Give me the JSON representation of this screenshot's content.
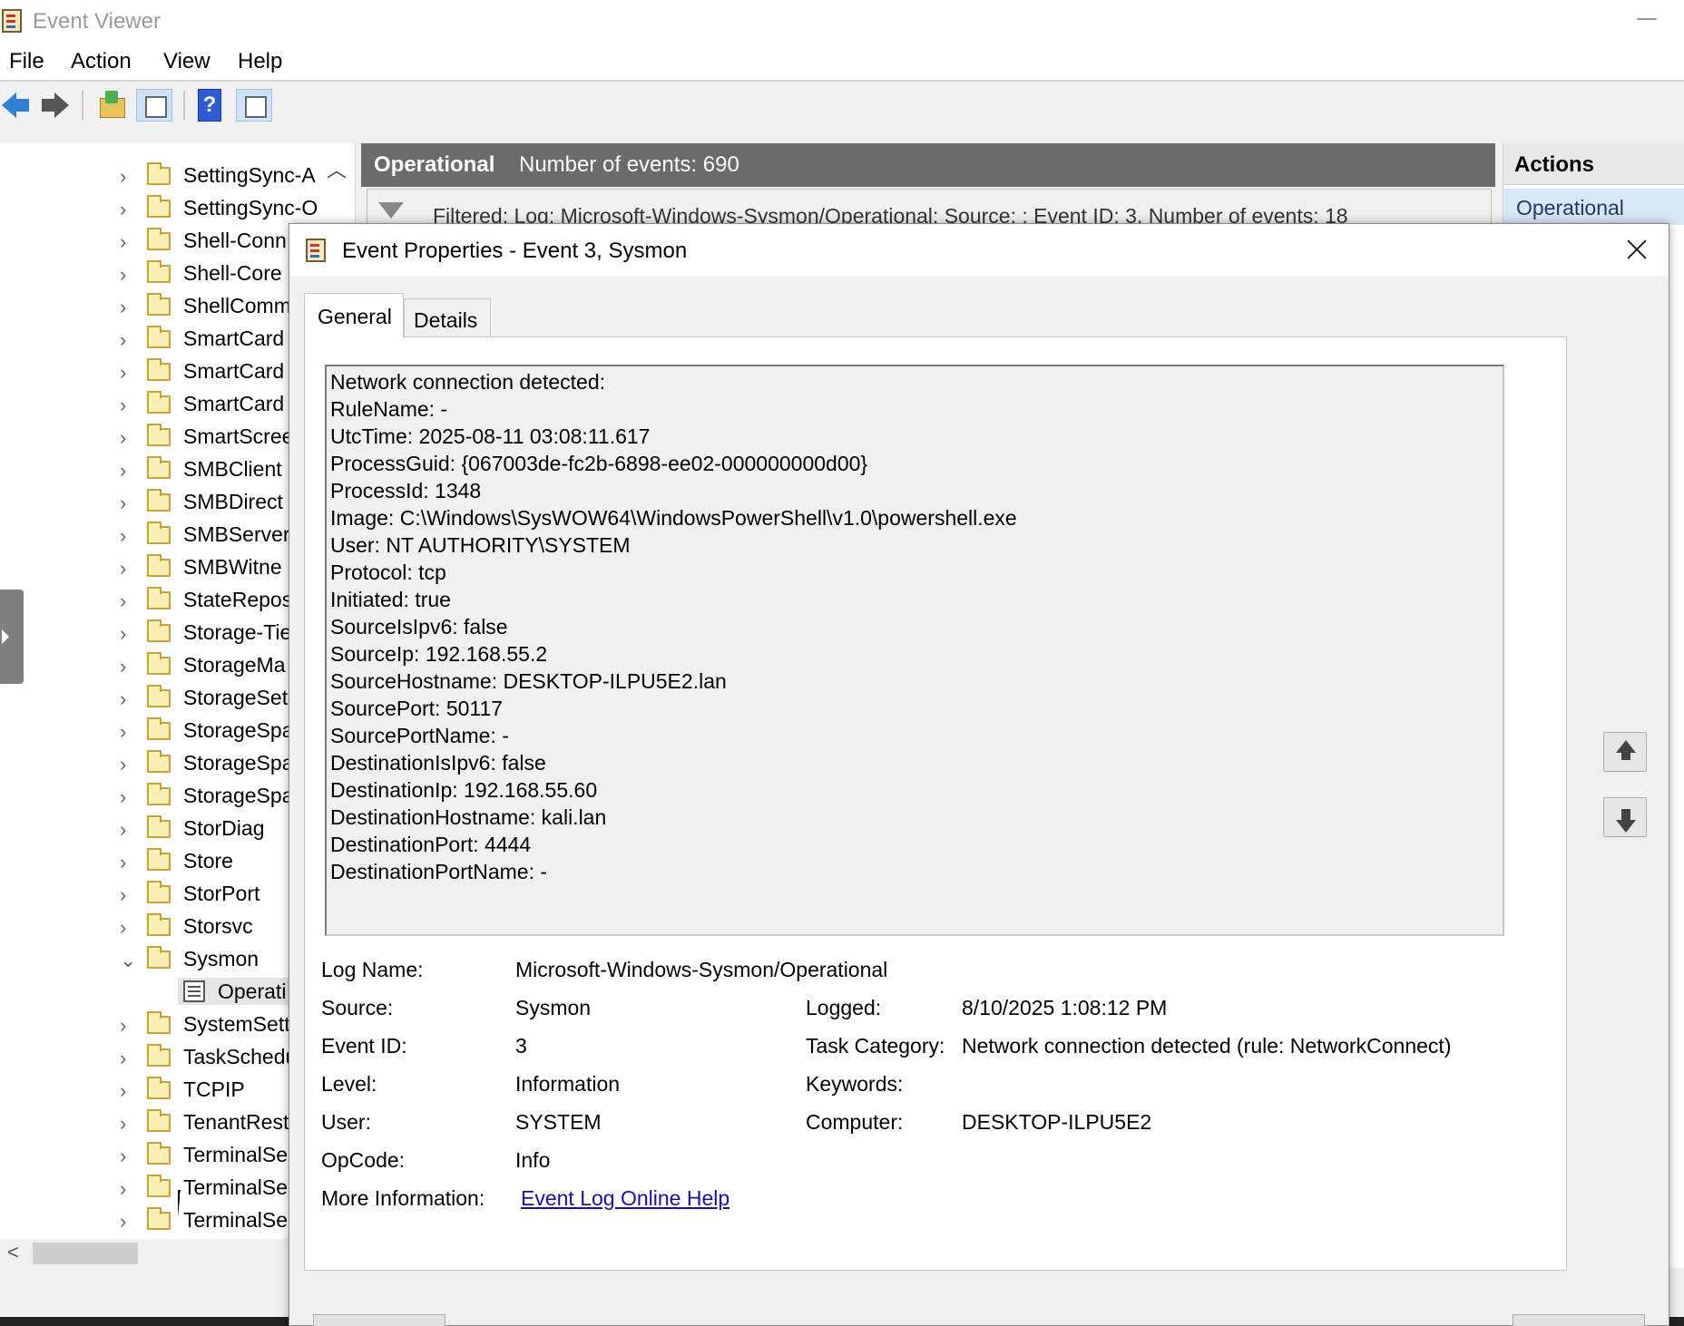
{
  "window": {
    "title": "Event Viewer"
  },
  "menu": [
    "File",
    "Action",
    "View",
    "Help"
  ],
  "tree": {
    "items": [
      "SettingSync-A",
      "SettingSync-O",
      "Shell-Conn",
      "Shell-Core",
      "ShellComm",
      "SmartCard",
      "SmartCard",
      "SmartCard",
      "SmartScree",
      "SMBClient",
      "SMBDirect",
      "SMBServer",
      "SMBWitne",
      "StateRepos",
      "Storage-Tie",
      "StorageMa",
      "StorageSet",
      "StorageSpa",
      "StorageSpa",
      "StorageSpa",
      "StorDiag",
      "Store",
      "StorPort",
      "Storsvc",
      "Sysmon",
      "Operati",
      "SystemSett",
      "TaskSchedu",
      "TCPIP",
      "TenantRest",
      "TerminalSe",
      "TerminalSe",
      "TerminalSe"
    ]
  },
  "center": {
    "log_name": "Operational",
    "event_count": "Number of events: 690",
    "filter_text": "Filtered: Log: Microsoft-Windows-Sysmon/Operational; Source: ; Event ID: 3. Number of events: 18"
  },
  "actions": {
    "header": "Actions",
    "selected": "Operational"
  },
  "dialog": {
    "title": "Event Properties - Event 3, Sysmon",
    "tabs": [
      "General",
      "Details"
    ],
    "description": [
      "Network connection detected:",
      "RuleName: -",
      "UtcTime: 2025-08-11 03:08:11.617",
      "ProcessGuid: {067003de-fc2b-6898-ee02-000000000d00}",
      "ProcessId: 1348",
      "Image: C:\\Windows\\SysWOW64\\WindowsPowerShell\\v1.0\\powershell.exe",
      "User: NT AUTHORITY\\SYSTEM",
      "Protocol: tcp",
      "Initiated: true",
      "SourceIsIpv6: false",
      "SourceIp: 192.168.55.2",
      "SourceHostname: DESKTOP-ILPU5E2.lan",
      "SourcePort: 50117",
      "SourcePortName: -",
      "DestinationIsIpv6: false",
      "DestinationIp: 192.168.55.60",
      "DestinationHostname: kali.lan",
      "DestinationPort: 4444",
      "DestinationPortName: -"
    ],
    "props": {
      "log_name_label": "Log Name:",
      "log_name": "Microsoft-Windows-Sysmon/Operational",
      "source_label": "Source:",
      "source": "Sysmon",
      "logged_label": "Logged:",
      "logged": "8/10/2025 1:08:12 PM",
      "event_id_label": "Event ID:",
      "event_id": "3",
      "task_category_label": "Task Category:",
      "task_category": "Network connection detected (rule: NetworkConnect)",
      "level_label": "Level:",
      "level": "Information",
      "keywords_label": "Keywords:",
      "keywords": "",
      "user_label": "User:",
      "user": "SYSTEM",
      "computer_label": "Computer:",
      "computer": "DESKTOP-ILPU5E2",
      "opcode_label": "OpCode:",
      "opcode": "Info",
      "more_info_label": "More Information:",
      "more_info_link": "Event Log Online Help"
    }
  }
}
